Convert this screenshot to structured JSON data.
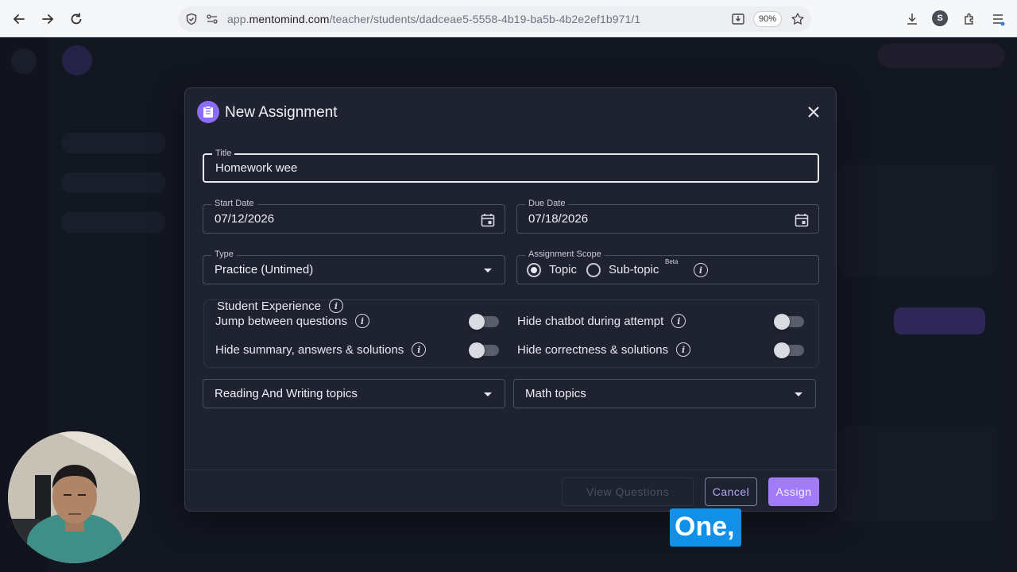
{
  "browser": {
    "url_prefix": "app.",
    "url_domain": "mentomind.com",
    "url_path": "/teacher/students/dadceae5-5558-4b19-ba5b-4b2e2ef1b971/1",
    "zoom": "90%",
    "profile_initial": "S"
  },
  "dialog": {
    "title": "New Assignment",
    "title_field": {
      "label": "Title",
      "value": "Homework wee"
    },
    "start_date": {
      "label": "Start Date",
      "value": "07/12/2026"
    },
    "due_date": {
      "label": "Due Date",
      "value": "07/18/2026"
    },
    "type": {
      "label": "Type",
      "value": "Practice (Untimed)"
    },
    "scope": {
      "label": "Assignment Scope",
      "options": [
        {
          "label": "Topic",
          "selected": true
        },
        {
          "label": "Sub-topic",
          "selected": false,
          "badge": "Beta"
        }
      ]
    },
    "student_experience": {
      "title": "Student Experience",
      "options": [
        {
          "label": "Jump between questions",
          "enabled": false
        },
        {
          "label": "Hide chatbot during attempt",
          "enabled": false
        },
        {
          "label": "Hide summary, answers & solutions",
          "enabled": false
        },
        {
          "label": "Hide correctness & solutions",
          "enabled": false
        }
      ]
    },
    "reading_topics": "Reading And Writing topics",
    "math_topics": "Math topics",
    "buttons": {
      "view_questions": "View Questions",
      "cancel": "Cancel",
      "assign": "Assign"
    }
  },
  "caption": "One,",
  "colors": {
    "accent": "#a27bf8",
    "dialog_bg": "#1f2231",
    "caption_bg": "#1190e8"
  }
}
